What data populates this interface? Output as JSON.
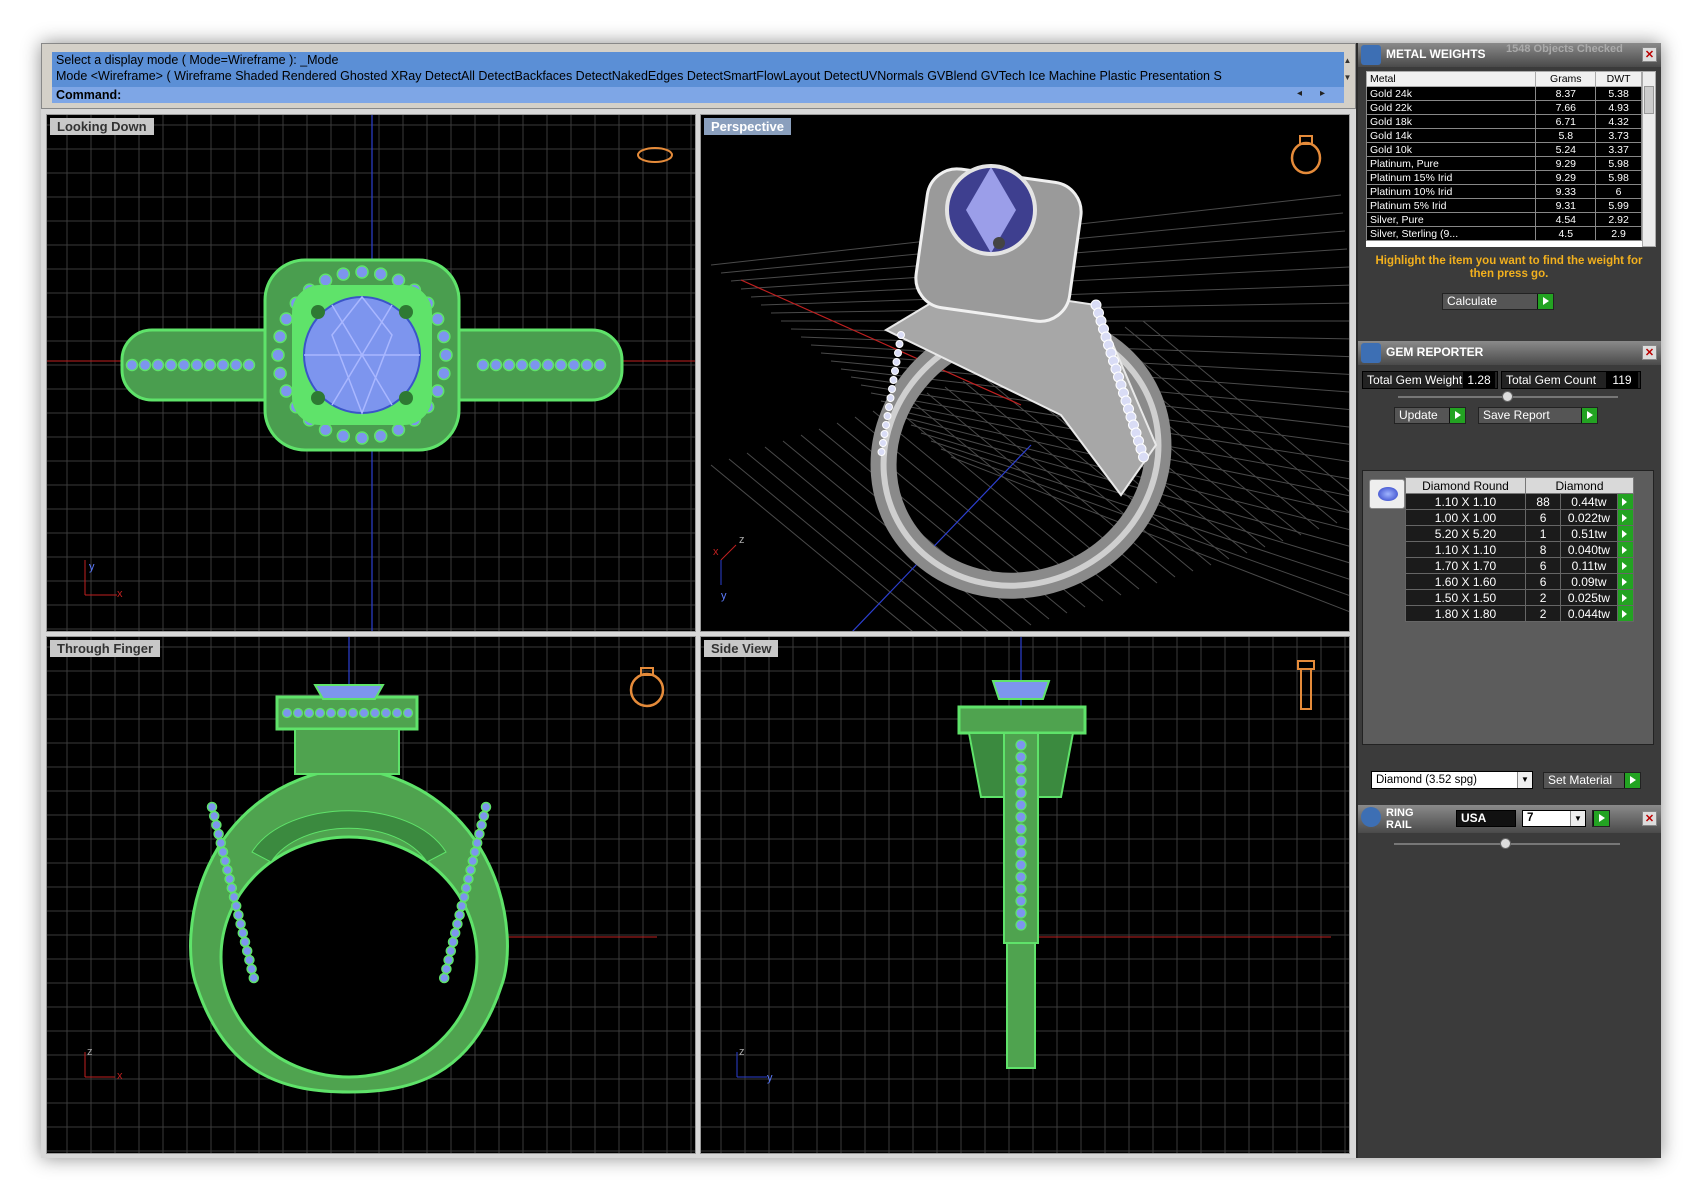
{
  "command": {
    "line1": "Select a display mode ( Mode=Wireframe ): _Mode",
    "line2": "Mode <Wireframe> ( Wireframe  Shaded  Rendered  Ghosted  XRay  DetectAll  DetectBackfaces  DetectNakedEdges  DetectSmartFlowLayout  DetectUVNormals  GVBlend  GVTech  Ice  Machine  Plastic  Presentation  S",
    "prompt": "Command:"
  },
  "viewports": {
    "top_left": "Looking Down",
    "top_right": "Perspective",
    "bottom_left": "Through Finger",
    "bottom_right": "Side View"
  },
  "axis_labels": {
    "x": "x",
    "y": "y",
    "z": "z"
  },
  "metal_weights": {
    "title": "METAL WEIGHTS",
    "status": "1548 Objects Checked",
    "columns": [
      "Metal",
      "Grams",
      "DWT"
    ],
    "rows": [
      [
        "Gold 24k",
        "8.37",
        "5.38"
      ],
      [
        "Gold 22k",
        "7.66",
        "4.93"
      ],
      [
        "Gold 18k",
        "6.71",
        "4.32"
      ],
      [
        "Gold 14k",
        "5.8",
        "3.73"
      ],
      [
        "Gold 10k",
        "5.24",
        "3.37"
      ],
      [
        "Platinum, Pure",
        "9.29",
        "5.98"
      ],
      [
        "Platinum 15% Irid",
        "9.29",
        "5.98"
      ],
      [
        "Platinum 10% Irid",
        "9.33",
        "6"
      ],
      [
        "Platinum 5% Irid",
        "9.31",
        "5.99"
      ],
      [
        "Silver, Pure",
        "4.54",
        "2.92"
      ],
      [
        "Silver, Sterling (9...",
        "4.5",
        "2.9"
      ]
    ],
    "note": "Highlight the item you want to find the weight for then press go.",
    "calculate_label": "Calculate"
  },
  "gem_reporter": {
    "title": "GEM REPORTER",
    "total_weight_label": "Total Gem Weight",
    "total_weight": "1.28",
    "total_count_label": "Total Gem Count",
    "total_count": "119",
    "update_label": "Update",
    "save_label": "Save Report",
    "columns": [
      "Diamond Round",
      "Diamond"
    ],
    "rows": [
      [
        "1.10 X 1.10",
        "88",
        "0.44tw"
      ],
      [
        "1.00 X 1.00",
        "6",
        "0.022tw"
      ],
      [
        "5.20 X 5.20",
        "1",
        "0.51tw"
      ],
      [
        "1.10 X 1.10",
        "8",
        "0.040tw"
      ],
      [
        "1.70 X 1.70",
        "6",
        "0.11tw"
      ],
      [
        "1.60 X 1.60",
        "6",
        "0.09tw"
      ],
      [
        "1.50 X 1.50",
        "2",
        "0.025tw"
      ],
      [
        "1.80 X 1.80",
        "2",
        "0.044tw"
      ]
    ],
    "material_select": "Diamond    (3.52 spg)",
    "set_material_label": "Set Material"
  },
  "ring_rail": {
    "title": "RING RAIL",
    "region": "USA",
    "size": "7"
  },
  "colors": {
    "wire_green": "#5fe36a",
    "gem_blue": "#7d95ee",
    "accent_orange": "#f2b01e",
    "go_green": "#23a322"
  }
}
